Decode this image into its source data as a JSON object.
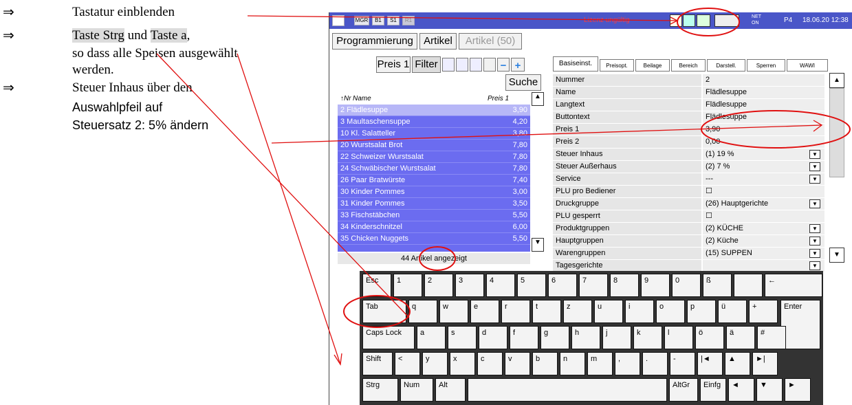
{
  "instructions": {
    "symbol": "⇒",
    "step1": "Tastatur einblenden",
    "step2_pre": "",
    "step2_key1": "Taste Strg",
    "step2_mid": " und ",
    "step2_key2": "Taste a",
    "step2_post": ",",
    "step2_line2": "so dass alle Speisen ausgewählt",
    "step2_line3": "werden.",
    "step3_line1": "Steuer Inhaus über den",
    "step3_line2": "Auswahlpfeil auf",
    "step3_line3": "Steuersatz 2: 5% ändern"
  },
  "topbar": {
    "boxes": [
      "MGR",
      "B1",
      "S1",
      "R1"
    ],
    "license": "Lizenz ungültig",
    "net": "NET",
    "net_state": "ON",
    "terminal": "P4",
    "datetime": "18.06.20 12:38"
  },
  "breadcrumb": [
    "Programmierung",
    "Artikel",
    "Artikel (50)"
  ],
  "toolbar": {
    "price": "Preis 1",
    "filter": "Filter",
    "search": "Suche"
  },
  "list": {
    "col_nr": "↑Nr",
    "col_name": "Name",
    "col_price": "Preis 1",
    "items": [
      {
        "nr": "2",
        "name": "Flädlesuppe",
        "price": "3,90"
      },
      {
        "nr": "3",
        "name": "Maultaschensuppe",
        "price": "4,20"
      },
      {
        "nr": "10",
        "name": "Kl. Salatteller",
        "price": "3,80"
      },
      {
        "nr": "20",
        "name": "Wurstsalat Brot",
        "price": "7,80"
      },
      {
        "nr": "22",
        "name": "Schweizer Wurstsalat",
        "price": "7,80"
      },
      {
        "nr": "24",
        "name": "Schwäbischer Wurstsalat",
        "price": "7,80"
      },
      {
        "nr": "26",
        "name": "Paar Bratwürste",
        "price": "7,40"
      },
      {
        "nr": "30",
        "name": "Kinder Pommes",
        "price": "3,00"
      },
      {
        "nr": "31",
        "name": "Kinder Pommes",
        "price": "3,50"
      },
      {
        "nr": "33",
        "name": "Fischstäbchen",
        "price": "5,50"
      },
      {
        "nr": "34",
        "name": "Kinderschnitzel",
        "price": "6,00"
      },
      {
        "nr": "35",
        "name": "Chicken Nuggets",
        "price": "5,50"
      }
    ],
    "count": "44 Artikel angezeigt"
  },
  "tabs": [
    "Basiseinst.",
    "Preisopt.",
    "Beilage",
    "Bereich",
    "Darstell.",
    "Sperren",
    "WAWI"
  ],
  "props": [
    {
      "label": "Nummer",
      "value": "2",
      "dd": false
    },
    {
      "label": "Name",
      "value": "Flädlesuppe",
      "dd": false
    },
    {
      "label": "Langtext",
      "value": "Flädlesuppe",
      "dd": false
    },
    {
      "label": "Buttontext",
      "value": "Flädlesuppe",
      "dd": false
    },
    {
      "label": "Preis 1",
      "value": "3,90",
      "dd": false
    },
    {
      "label": "Preis 2",
      "value": "0,00",
      "dd": false
    },
    {
      "label": "Steuer Inhaus",
      "value": "(1) 19 %",
      "dd": true
    },
    {
      "label": "Steuer Außerhaus",
      "value": "(2) 7 %",
      "dd": true
    },
    {
      "label": "Service",
      "value": "---",
      "dd": true
    },
    {
      "label": "PLU pro Bediener",
      "value": "☐",
      "dd": false
    },
    {
      "label": "Druckgruppe",
      "value": "(26) Hauptgerichte",
      "dd": true
    },
    {
      "label": "PLU gesperrt",
      "value": "☐",
      "dd": false
    },
    {
      "label": "Produktgruppen",
      "value": "(2) KÜCHE",
      "dd": true
    },
    {
      "label": "Hauptgruppen",
      "value": "(2) Küche",
      "dd": true
    },
    {
      "label": "Warengruppen",
      "value": "(15) SUPPEN",
      "dd": true
    },
    {
      "label": "Tagesgerichte",
      "value": "",
      "dd": true
    }
  ],
  "keyboard": {
    "row1": [
      "Esc",
      "1",
      "2",
      "3",
      "4",
      "5",
      "6",
      "7",
      "8",
      "9",
      "0",
      "ß",
      "",
      "←"
    ],
    "row2": [
      "Tab",
      "q",
      "w",
      "e",
      "r",
      "t",
      "z",
      "u",
      "i",
      "o",
      "p",
      "ü",
      "+",
      "Enter"
    ],
    "row3": [
      "Caps Lock",
      "a",
      "s",
      "d",
      "f",
      "g",
      "h",
      "j",
      "k",
      "l",
      "ö",
      "ä",
      "#"
    ],
    "row4": [
      "Shift",
      "<",
      "y",
      "x",
      "c",
      "v",
      "b",
      "n",
      "m",
      ",",
      ".",
      "-",
      "|◄",
      "▲",
      "►|"
    ],
    "row5": [
      "Strg",
      "Num",
      "Alt",
      "",
      "AltGr",
      "Einfg",
      "◄",
      "▼",
      "►"
    ]
  },
  "colors": {
    "annotation": "#e01010",
    "list_bg": "#6b6cf0",
    "topbar": "#4a56c8"
  }
}
